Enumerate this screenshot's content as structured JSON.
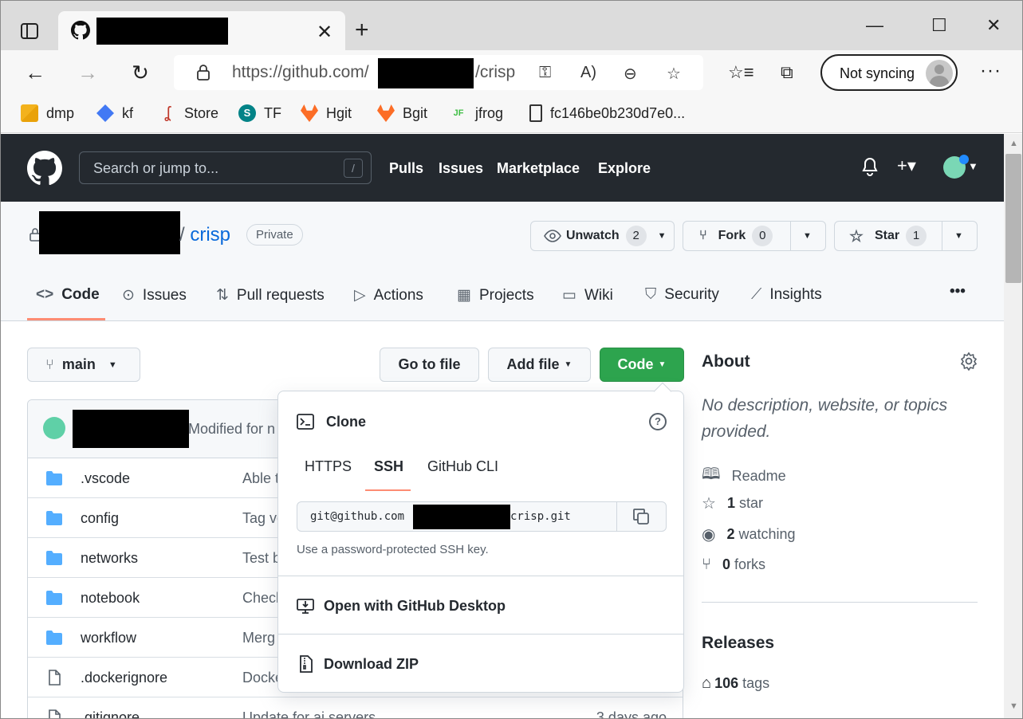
{
  "browser": {
    "tab_close": "✕",
    "new_tab": "+",
    "url_prefix": "https://github.com/",
    "url_suffix": "/crisp",
    "sync_label": "Not syncing",
    "window_controls": {
      "minimize": "—",
      "maximize": "☐",
      "close": "✕"
    },
    "favorites": [
      {
        "label": "dmp",
        "icon": "yellow-squares-icon"
      },
      {
        "label": "kf",
        "icon": "kubeflow-icon"
      },
      {
        "label": "Store",
        "icon": "store-icon"
      },
      {
        "label": "TF",
        "icon": "sharepoint-icon"
      },
      {
        "label": "Hgit",
        "icon": "gitlab-icon"
      },
      {
        "label": "Bgit",
        "icon": "gitlab-icon"
      },
      {
        "label": "jfrog",
        "icon": "jfrog-icon"
      },
      {
        "label": "fc146be0b230d7e0...",
        "icon": "file-icon"
      }
    ]
  },
  "github": {
    "search_placeholder": "Search or jump to...",
    "search_shortcut": "/",
    "nav": [
      "Pulls",
      "Issues",
      "Marketplace",
      "Explore"
    ]
  },
  "repo": {
    "name": "crisp",
    "separator": "/",
    "visibility": "Private",
    "watch": {
      "label": "Unwatch",
      "count": "2"
    },
    "fork": {
      "label": "Fork",
      "count": "0"
    },
    "star": {
      "label": "Star",
      "count": "1"
    },
    "tabs": [
      "Code",
      "Issues",
      "Pull requests",
      "Actions",
      "Projects",
      "Wiki",
      "Security",
      "Insights"
    ],
    "more": "•••"
  },
  "toolbar": {
    "branch": "main",
    "goto_file": "Go to file",
    "add_file": "Add file",
    "code": "Code"
  },
  "commit": {
    "message": "Modified for n"
  },
  "files": [
    {
      "name": ".vscode",
      "type": "folder",
      "message": "Able t",
      "age": ""
    },
    {
      "name": "config",
      "type": "folder",
      "message": "Tag ve",
      "age": ""
    },
    {
      "name": "networks",
      "type": "folder",
      "message": "Test b",
      "age": ""
    },
    {
      "name": "notebook",
      "type": "folder",
      "message": "Check",
      "age": ""
    },
    {
      "name": "workflow",
      "type": "folder",
      "message": "Merg",
      "age": ""
    },
    {
      "name": ".dockerignore",
      "type": "file",
      "message": "Docke",
      "age": ""
    },
    {
      "name": ".gitignore",
      "type": "file",
      "message": "Update for ai servers",
      "age": "3 days ago"
    }
  ],
  "clone": {
    "title": "Clone",
    "help": "?",
    "tabs": [
      "HTTPS",
      "SSH",
      "GitHub CLI"
    ],
    "active_tab": "SSH",
    "url_prefix": "git@github.com",
    "url_suffix": "crisp.git",
    "hint": "Use a password-protected SSH key.",
    "open_desktop": "Open with GitHub Desktop",
    "download_zip": "Download ZIP"
  },
  "about": {
    "title": "About",
    "description": "No description, website, or topics provided.",
    "readme": "Readme",
    "stars": {
      "count": "1",
      "label": "star"
    },
    "watching": {
      "count": "2",
      "label": "watching"
    },
    "forks": {
      "count": "0",
      "label": "forks"
    },
    "releases_title": "Releases",
    "tags": {
      "count": "106",
      "label": "tags"
    }
  }
}
